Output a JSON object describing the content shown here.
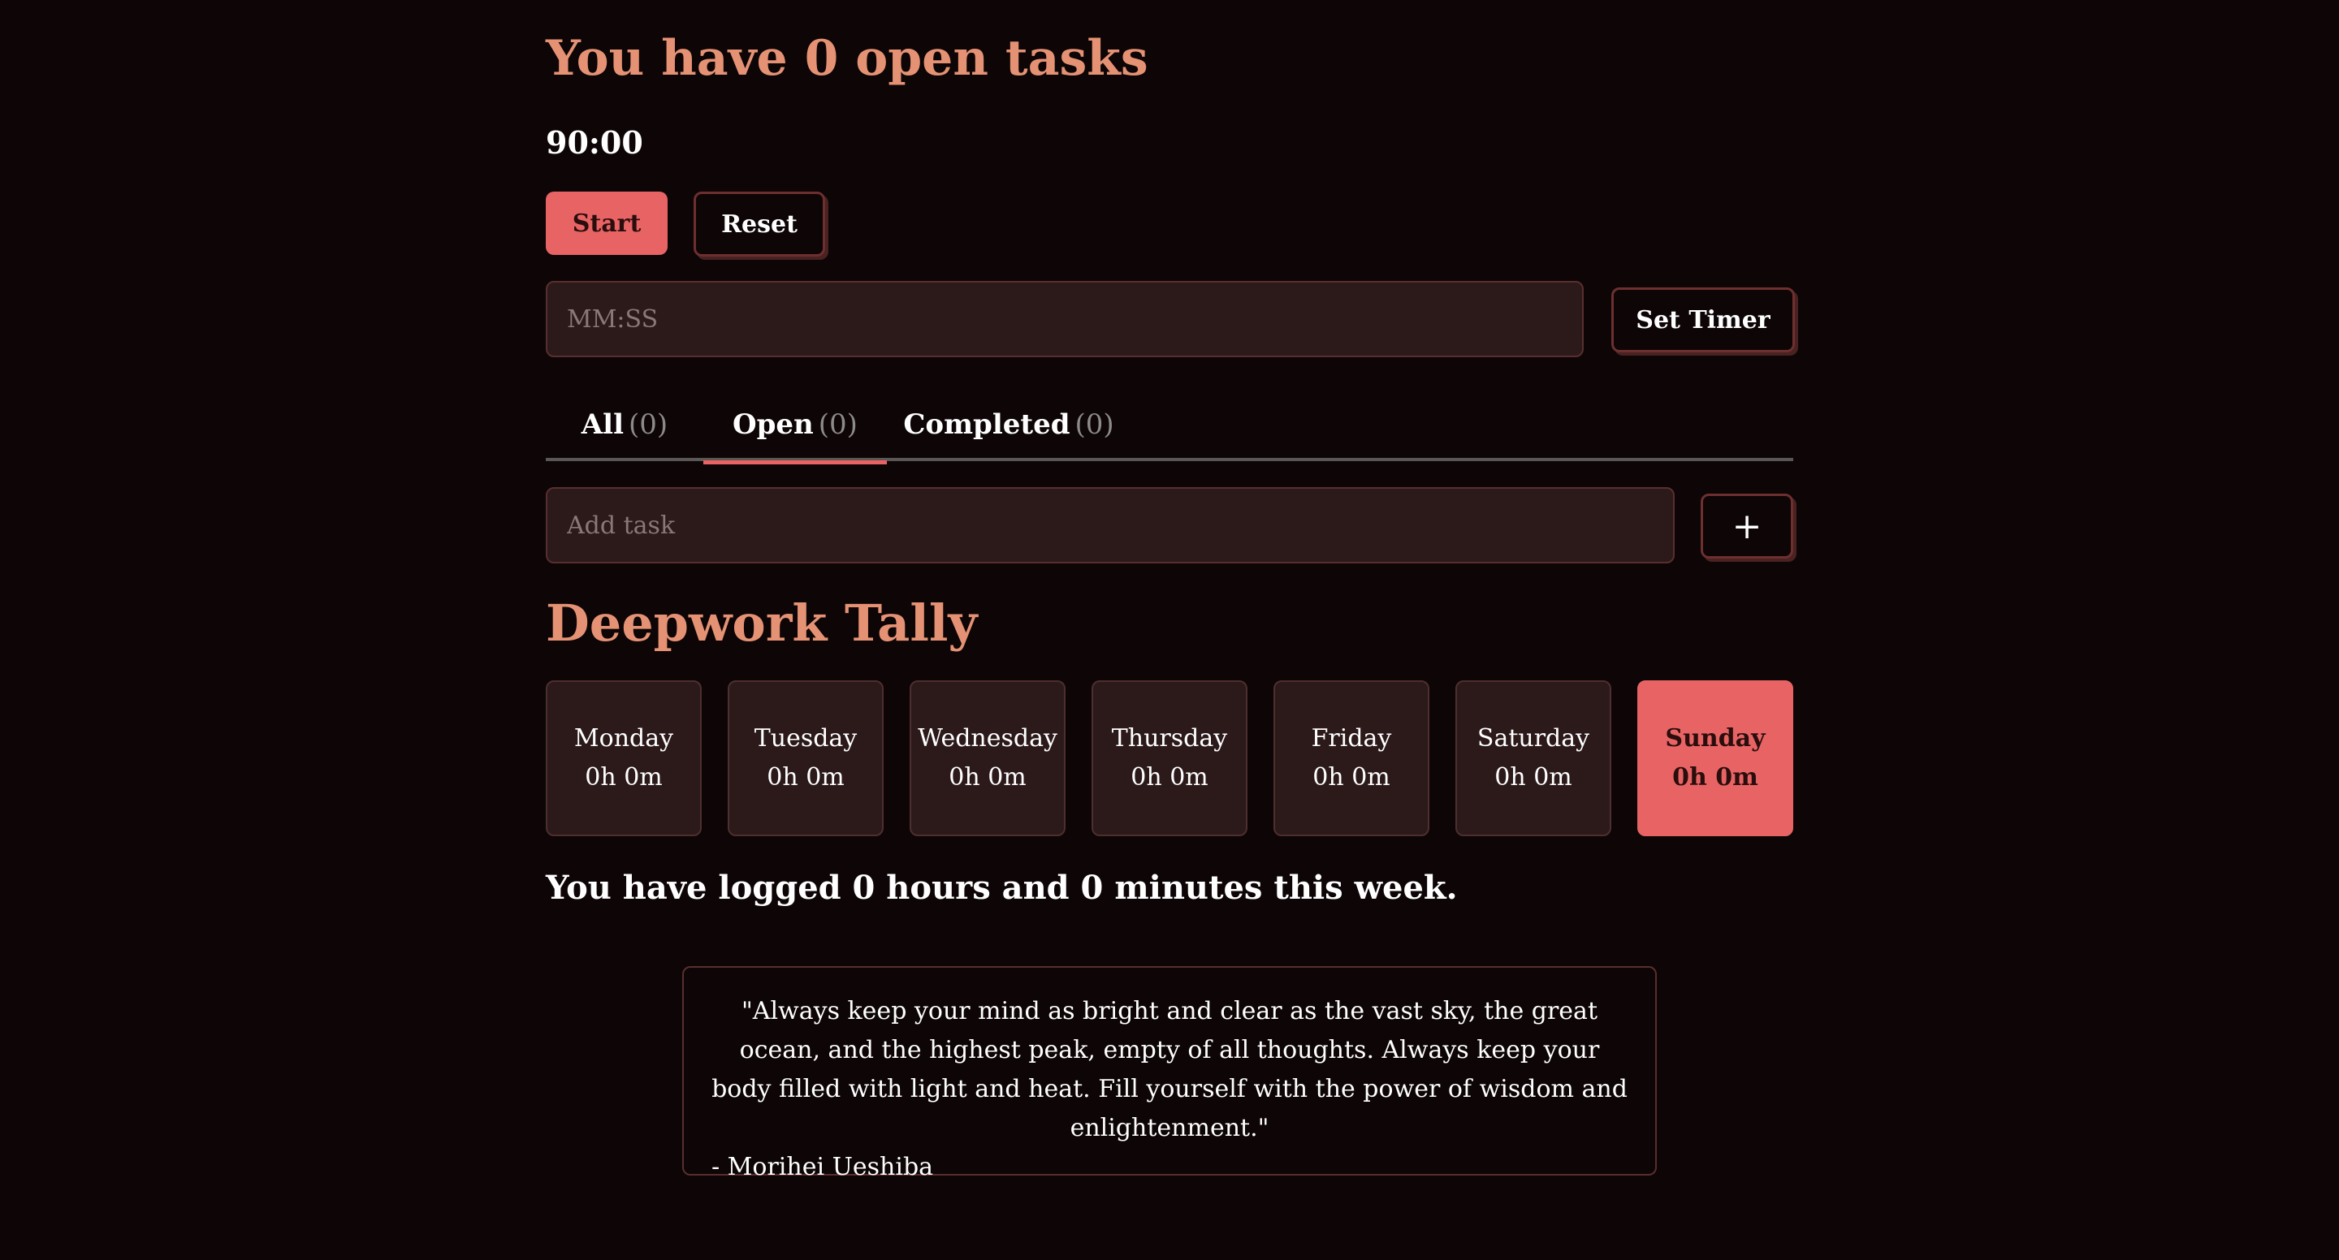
{
  "tasks": {
    "heading": "You have 0 open tasks"
  },
  "timer": {
    "display": "90:00",
    "start_label": "Start",
    "reset_label": "Reset",
    "input_placeholder": "MM:SS",
    "input_value": "",
    "set_label": "Set Timer"
  },
  "tabs": [
    {
      "label": "All",
      "count": "(0)"
    },
    {
      "label": "Open",
      "count": "(0)",
      "active": true
    },
    {
      "label": "Completed",
      "count": "(0)"
    }
  ],
  "add_task": {
    "placeholder": "Add task",
    "value": "",
    "button_label": "+"
  },
  "tally": {
    "heading": "Deepwork Tally",
    "days": [
      {
        "day": "Monday",
        "time": "0h 0m"
      },
      {
        "day": "Tuesday",
        "time": "0h 0m"
      },
      {
        "day": "Wednesday",
        "time": "0h 0m"
      },
      {
        "day": "Thursday",
        "time": "0h 0m"
      },
      {
        "day": "Friday",
        "time": "0h 0m"
      },
      {
        "day": "Saturday",
        "time": "0h 0m"
      },
      {
        "day": "Sunday",
        "time": "0h 0m",
        "active": true
      }
    ],
    "summary": "You have logged 0 hours and 0 minutes this week."
  },
  "quote": {
    "text": "\"Always keep your mind as bright and clear as the vast sky, the great ocean, and the highest peak, empty of all thoughts. Always keep your body filled with light and heat. Fill yourself with the power of wisdom and enlightenment.\"",
    "author": "- Morihei Ueshiba"
  },
  "colors": {
    "background": "#0d0506",
    "accent": "#e86464",
    "heading": "#e59274",
    "surface": "#2c1a1b",
    "border": "#5a2e2e"
  }
}
